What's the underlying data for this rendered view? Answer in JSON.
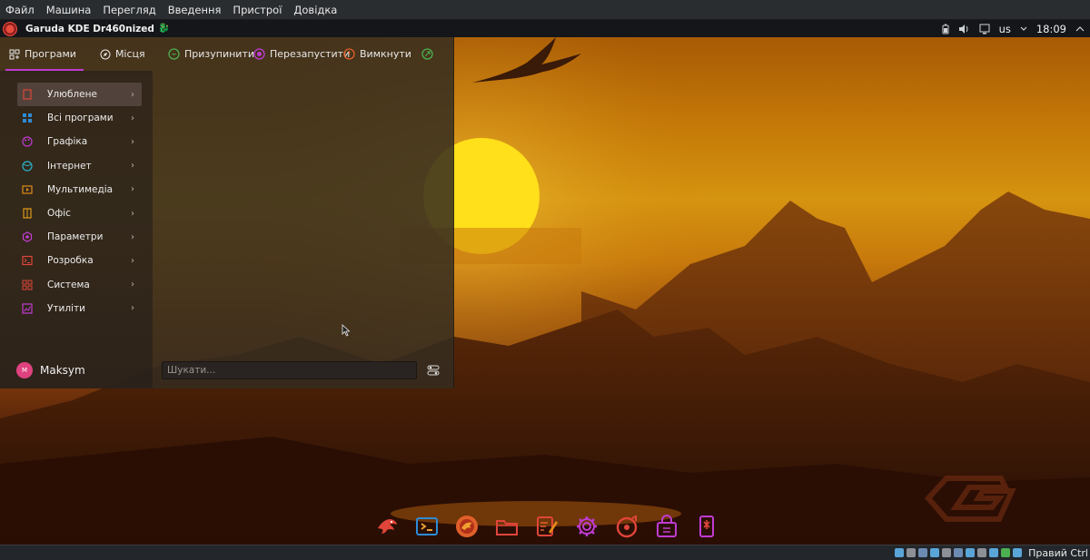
{
  "vbox_menu": [
    "Файл",
    "Машина",
    "Перегляд",
    "Введення",
    "Пристрої",
    "Довідка"
  ],
  "kde_panel": {
    "window_title": "Garuda KDE Dr460nized",
    "keyboard_layout": "us",
    "clock": "18:09",
    "tray_icons": [
      "battery-icon",
      "volume-icon",
      "network-icon",
      "chevron-up-icon"
    ]
  },
  "launcher": {
    "tabs": [
      {
        "label": "Програми",
        "icon": "apps-grid-icon",
        "active": true
      },
      {
        "label": "Місця",
        "icon": "compass-icon",
        "active": false
      }
    ],
    "session_buttons": [
      {
        "label": "Призупинити",
        "icon": "sleep-icon",
        "color": "#4caf50"
      },
      {
        "label": "Перезапустити",
        "icon": "restart-icon",
        "color": "#c03bd1"
      },
      {
        "label": "Вимкнути",
        "icon": "power-icon",
        "color": "#e0602a"
      }
    ],
    "categories": [
      {
        "label": "Улюблене",
        "icon": "bookmark-icon",
        "color": "#e0453a",
        "active": true
      },
      {
        "label": "Всі програми",
        "icon": "grid-icon",
        "color": "#2e8bd6"
      },
      {
        "label": "Графіка",
        "icon": "palette-icon",
        "color": "#c03bd1"
      },
      {
        "label": "Інтернет",
        "icon": "globe-icon",
        "color": "#2ab3c9"
      },
      {
        "label": "Мультимедіа",
        "icon": "media-icon",
        "color": "#e08a18"
      },
      {
        "label": "Офіс",
        "icon": "office-icon",
        "color": "#e09a18"
      },
      {
        "label": "Параметри",
        "icon": "settings-icon",
        "color": "#c03bd1"
      },
      {
        "label": "Розробка",
        "icon": "terminal-icon",
        "color": "#e0453a"
      },
      {
        "label": "Система",
        "icon": "system-icon",
        "color": "#e0453a"
      },
      {
        "label": "Утиліти",
        "icon": "utilities-icon",
        "color": "#c03bd1"
      }
    ],
    "user": {
      "name": "Maksym",
      "avatar_initial": "M"
    },
    "search_placeholder": "Шукати..."
  },
  "dock_items": [
    "garuda-assistant-icon",
    "terminal-icon",
    "garuda-firefox-icon",
    "file-manager-icon",
    "text-editor-icon",
    "settings-icon",
    "music-player-icon",
    "software-store-icon",
    "kdeconnect-icon"
  ],
  "vbox_status": {
    "host_key": "Правий Ctrl"
  },
  "colors": {
    "accent": "#c03bd1",
    "dock_red": "#e0453a",
    "dock_purple": "#c03bd1"
  }
}
